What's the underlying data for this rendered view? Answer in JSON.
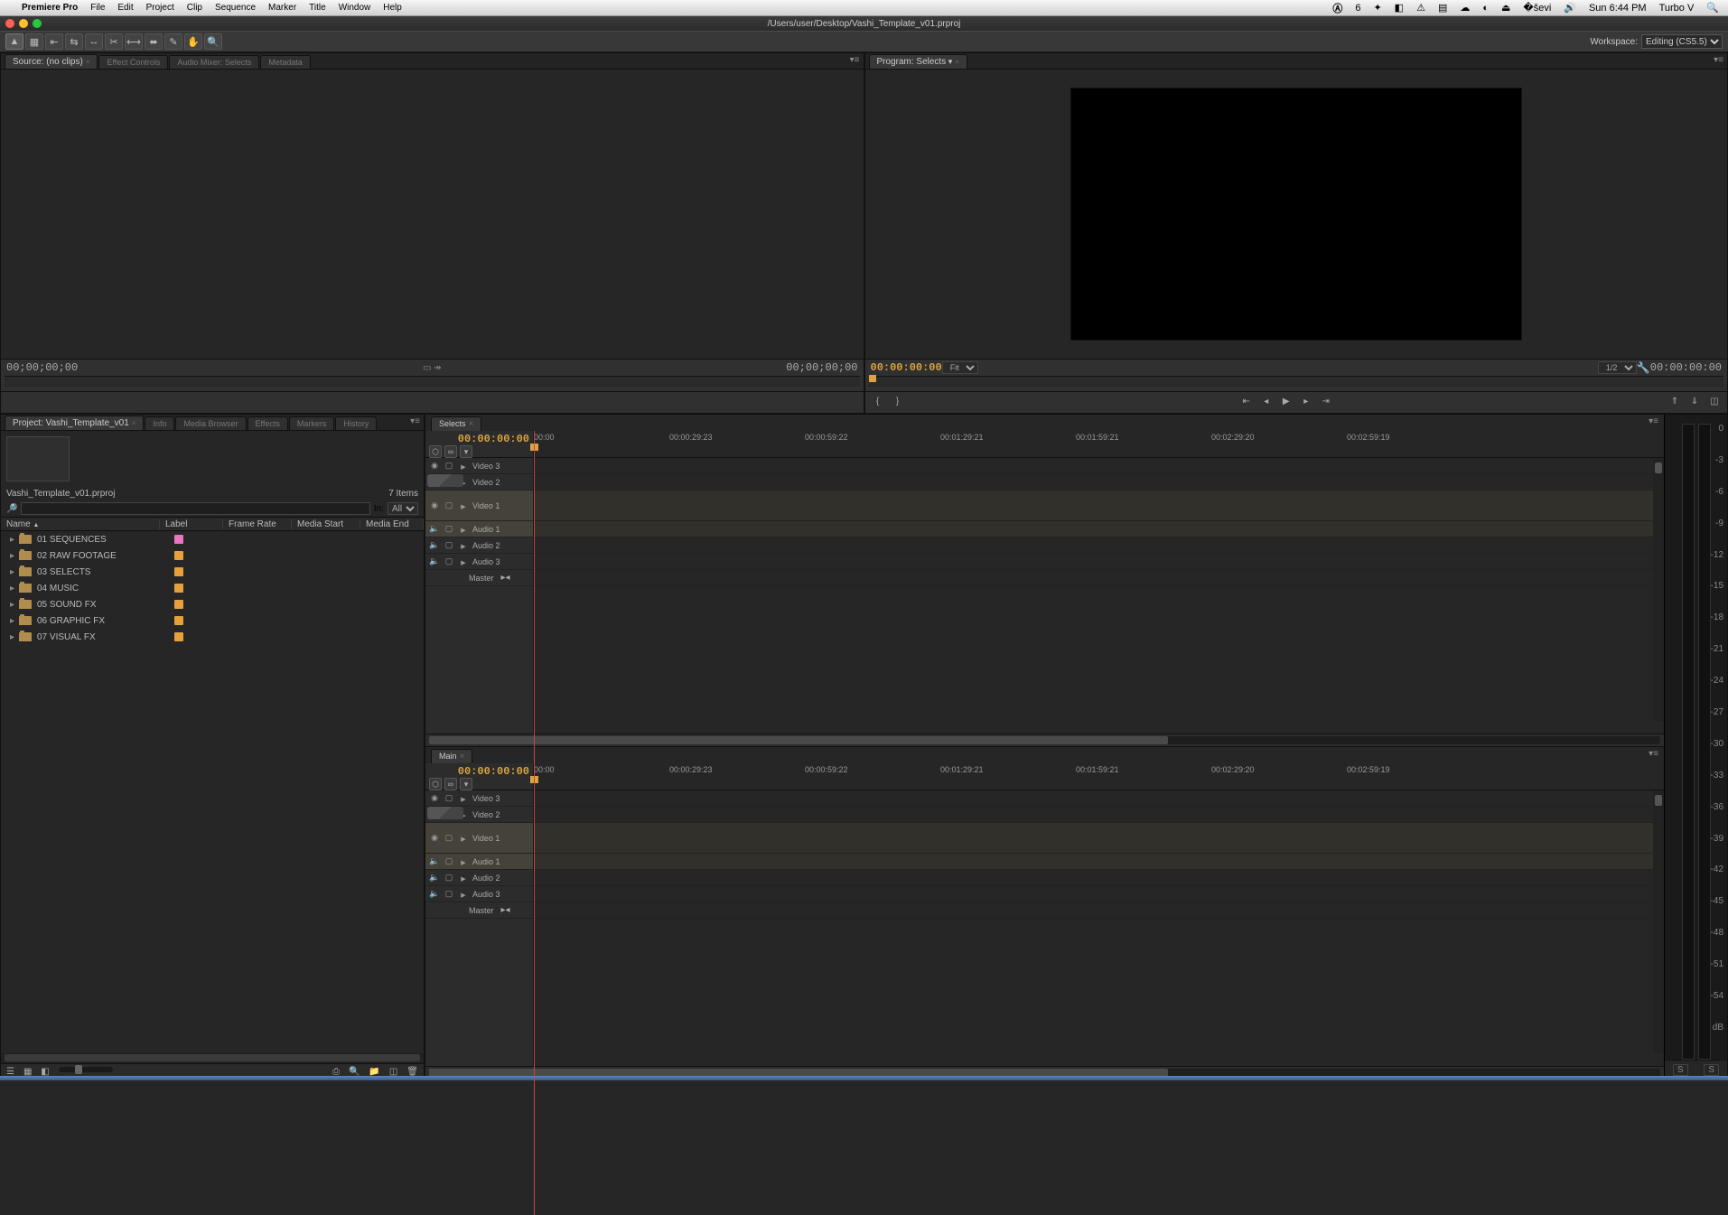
{
  "mac_menu": {
    "app": "Premiere Pro",
    "items": [
      "File",
      "Edit",
      "Project",
      "Clip",
      "Sequence",
      "Marker",
      "Title",
      "Window",
      "Help"
    ],
    "right": [
      "6",
      "Sun 6:44 PM",
      "Turbo V"
    ]
  },
  "titlebar_path": "/Users/user/Desktop/Vashi_Template_v01.prproj",
  "workspace": {
    "label": "Workspace:",
    "value": "Editing (CS5.5)"
  },
  "source_tabs": [
    "Source: (no clips)",
    "Effect Controls",
    "Audio Mixer: Selects",
    "Metadata"
  ],
  "source": {
    "tc_left": "00;00;00;00",
    "tc_right": "00;00;00;00"
  },
  "program_tabs": [
    "Program: Selects"
  ],
  "program": {
    "tc_left": "00:00:00:00",
    "tc_right": "00:00:00:00",
    "fit": "Fit",
    "quality": "1/2"
  },
  "project_tabs": [
    "Project: Vashi_Template_v01",
    "Info",
    "Media Browser",
    "Effects",
    "Markers",
    "History"
  ],
  "project": {
    "filename": "Vashi_Template_v01.prproj",
    "item_count": "7 Items",
    "search_in_label": "In:",
    "search_in_value": "All",
    "cols": [
      "Name",
      "Label",
      "Frame Rate",
      "Media Start",
      "Media End"
    ],
    "bins": [
      {
        "name": "01 SEQUENCES",
        "label": "#e876c1"
      },
      {
        "name": "02 RAW FOOTAGE",
        "label": "#e5a13c"
      },
      {
        "name": "03 SELECTS",
        "label": "#e5a13c"
      },
      {
        "name": "04 MUSIC",
        "label": "#e5a13c"
      },
      {
        "name": "05 SOUND FX",
        "label": "#e5a13c"
      },
      {
        "name": "06 GRAPHIC FX",
        "label": "#e5a13c"
      },
      {
        "name": "07 VISUAL FX",
        "label": "#e5a13c"
      }
    ]
  },
  "timelines": [
    {
      "name": "Selects",
      "tc": "00:00:00:00",
      "ruler": [
        "00:00",
        "00:00:29:23",
        "00:00:59:22",
        "00:01:29:21",
        "00:01:59:21",
        "00:02:29:20",
        "00:02:59:19"
      ],
      "video": [
        "Video 3",
        "Video 2",
        "Video 1"
      ],
      "audio": [
        "Audio 1",
        "Audio 2",
        "Audio 3"
      ],
      "master": "Master"
    },
    {
      "name": "Main",
      "tc": "00:00:00:00",
      "ruler": [
        "00:00",
        "00:00:29:23",
        "00:00:59:22",
        "00:01:29:21",
        "00:01:59:21",
        "00:02:29:20",
        "00:02:59:19"
      ],
      "video": [
        "Video 3",
        "Video 2",
        "Video 1"
      ],
      "audio": [
        "Audio 1",
        "Audio 2",
        "Audio 3"
      ],
      "master": "Master"
    }
  ],
  "meter_scale": [
    "0",
    "-3",
    "-6",
    "-9",
    "-12",
    "-15",
    "-18",
    "-21",
    "-24",
    "-27",
    "-30",
    "-33",
    "-36",
    "-39",
    "-42",
    "-45",
    "-48",
    "-51",
    "-54",
    "dB"
  ],
  "meter_foot": [
    "S",
    "S"
  ]
}
